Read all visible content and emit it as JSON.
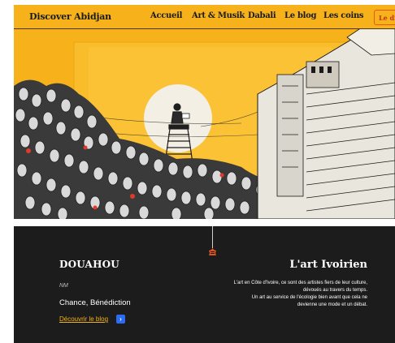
{
  "header": {
    "brand": "Discover Abidjan",
    "nav": [
      "Accueil",
      "Art & Musik",
      "Dabali",
      "Le blog",
      "Les coins"
    ],
    "cta_label": "Le di"
  },
  "colors": {
    "accent": "#f7b21b",
    "dark_band": "#1c1c1c",
    "link": "#f2b318",
    "arrow_button": "#2d6bf2",
    "cta_border": "#e05a14"
  },
  "hero": {
    "artwork_description_icons": [
      "sun-icon",
      "figure-on-ladder-icon",
      "crowd-icon",
      "building-icon"
    ]
  },
  "section": {
    "left_title": "DOUAHOU",
    "left_sub": "NM",
    "left_names": "Chance, Bénédiction",
    "link_label": "Découvrir le blog",
    "arrow_glyph": "›",
    "right_title": "L'art Ivoirien",
    "right_lines": [
      "L'art en Côte d'Ivoire, ce sont des artistes fiers de leur culture,",
      "dévoués au travers du temps.",
      "Un art au service de l'écologie bien avant que cela ne",
      "devienne une mode et un débat."
    ]
  }
}
